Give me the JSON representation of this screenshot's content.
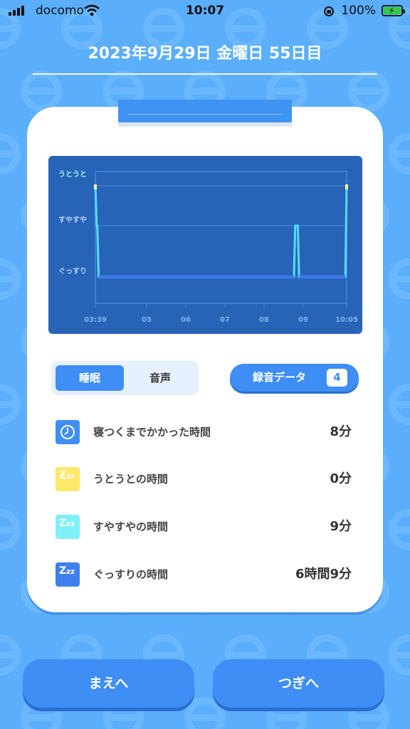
{
  "status_bar": {
    "carrier": "docomo",
    "time": "10:07",
    "battery": "100%"
  },
  "header": {
    "date": "2023年9月29日 金曜日 55日目"
  },
  "chart_data": {
    "type": "line",
    "y_categories": [
      "うとうと",
      "すやすや",
      "ぐっすり"
    ],
    "x_tick_labels": [
      "03:39",
      "05",
      "06",
      "07",
      "08",
      "09",
      "10:05"
    ],
    "x_unit": "time of day",
    "series": [
      {
        "points": [
          {
            "t": "03:39",
            "level": "うとうと"
          },
          {
            "t": "03:41",
            "level": "すやすや"
          },
          {
            "t": "03:42",
            "level": "すやすや"
          },
          {
            "t": "03:44",
            "level": "ぐっすり"
          },
          {
            "t": "08:44",
            "level": "ぐっすり"
          },
          {
            "t": "08:46",
            "level": "すやすや"
          },
          {
            "t": "08:50",
            "level": "すやすや"
          },
          {
            "t": "08:52",
            "level": "ぐっすり"
          },
          {
            "t": "10:03",
            "level": "ぐっすり"
          },
          {
            "t": "10:05",
            "level": "うとうと"
          }
        ]
      }
    ],
    "colors": {
      "line": "#55ddff",
      "deep_line": "#3a78e8",
      "light_dot": "#fff89a"
    }
  },
  "tabs": [
    {
      "label": "睡眠",
      "active": true
    },
    {
      "label": "音声",
      "active": false
    }
  ],
  "recording": {
    "label": "録音データ",
    "count": "4"
  },
  "stats": [
    {
      "icon": "clock-icon",
      "label": "寝つくまでかかった時間",
      "value": "8分",
      "color": "#3f8ef5"
    },
    {
      "icon": "sleep-light-icon",
      "label": "うとうとの時間",
      "value": "0分",
      "color": "#ffe86a"
    },
    {
      "icon": "sleep-medium-icon",
      "label": "すやすやの時間",
      "value": "9分",
      "color": "#7ff0f8"
    },
    {
      "icon": "sleep-deep-icon",
      "label": "ぐっすりの時間",
      "value": "6時間9分",
      "color": "#3f80ee"
    }
  ],
  "nav": {
    "prev_label": "まえへ",
    "next_label": "つぎへ"
  }
}
